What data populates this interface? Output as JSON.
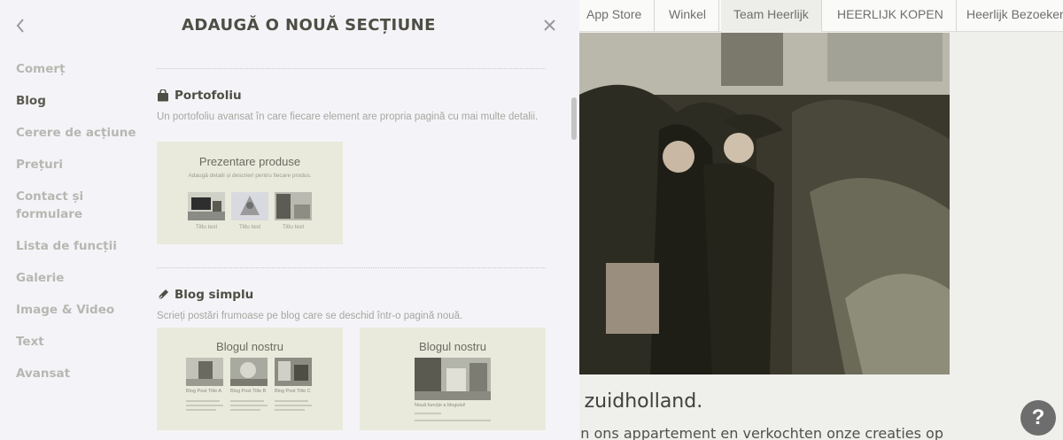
{
  "panel": {
    "title": "ADAUGĂ O NOUĂ SECȚIUNE",
    "back_icon": "chevron-left-icon",
    "close_icon": "close-icon"
  },
  "nav": {
    "items": [
      {
        "label": "Comerț",
        "active": false
      },
      {
        "label": "Blog",
        "active": true
      },
      {
        "label": "Cerere de acțiune",
        "active": false
      },
      {
        "label": "Prețuri",
        "active": false
      },
      {
        "label": "Contact și formulare",
        "active": false
      },
      {
        "label": "Lista de funcții",
        "active": false
      },
      {
        "label": "Galerie",
        "active": false
      },
      {
        "label": "Image & Video",
        "active": false
      },
      {
        "label": "Text",
        "active": false
      },
      {
        "label": "Avansat",
        "active": false
      }
    ]
  },
  "portfolio": {
    "icon": "bag-icon",
    "title": "Portofoliu",
    "description": "Un portofoliu avansat în care fiecare element are propria pagină cu mai multe detalii.",
    "card": {
      "title": "Prezentare produse",
      "subtitle": "Adaugă detalii și descrieri pentru fiecare produs.",
      "item_labels": [
        "Titlu text",
        "Titlu text",
        "Titlu text"
      ]
    }
  },
  "blog": {
    "icon": "pen-icon",
    "title": "Blog simplu",
    "description": "Scrieți postări frumoase pe blog care se deschid într-o pagină nouă.",
    "card1": {
      "title": "Blogul nostru",
      "posts": [
        "Blog Post Title A",
        "Blog Post Title B",
        "Blog Post Title C"
      ]
    },
    "card2": {
      "title": "Blogul nostru",
      "post_title": "Nouă funcție a blogului!"
    }
  },
  "preview": {
    "tabs": [
      "App Store",
      "Winkel",
      "Team Heerlijk",
      "HEERLIJK KOPEN",
      "Heerlijk Bezoeken"
    ],
    "headline": "t zuidholland.",
    "paragraph": "van ons appartement en verkochten onze creaties op",
    "help_label": "?"
  },
  "colors": {
    "panel_bg": "#f4f4f8",
    "card_bg": "#e9eadb",
    "nav_active": "#5a5a50",
    "nav_inactive": "#b7b7b2",
    "help_bg": "#6d6d6d"
  }
}
